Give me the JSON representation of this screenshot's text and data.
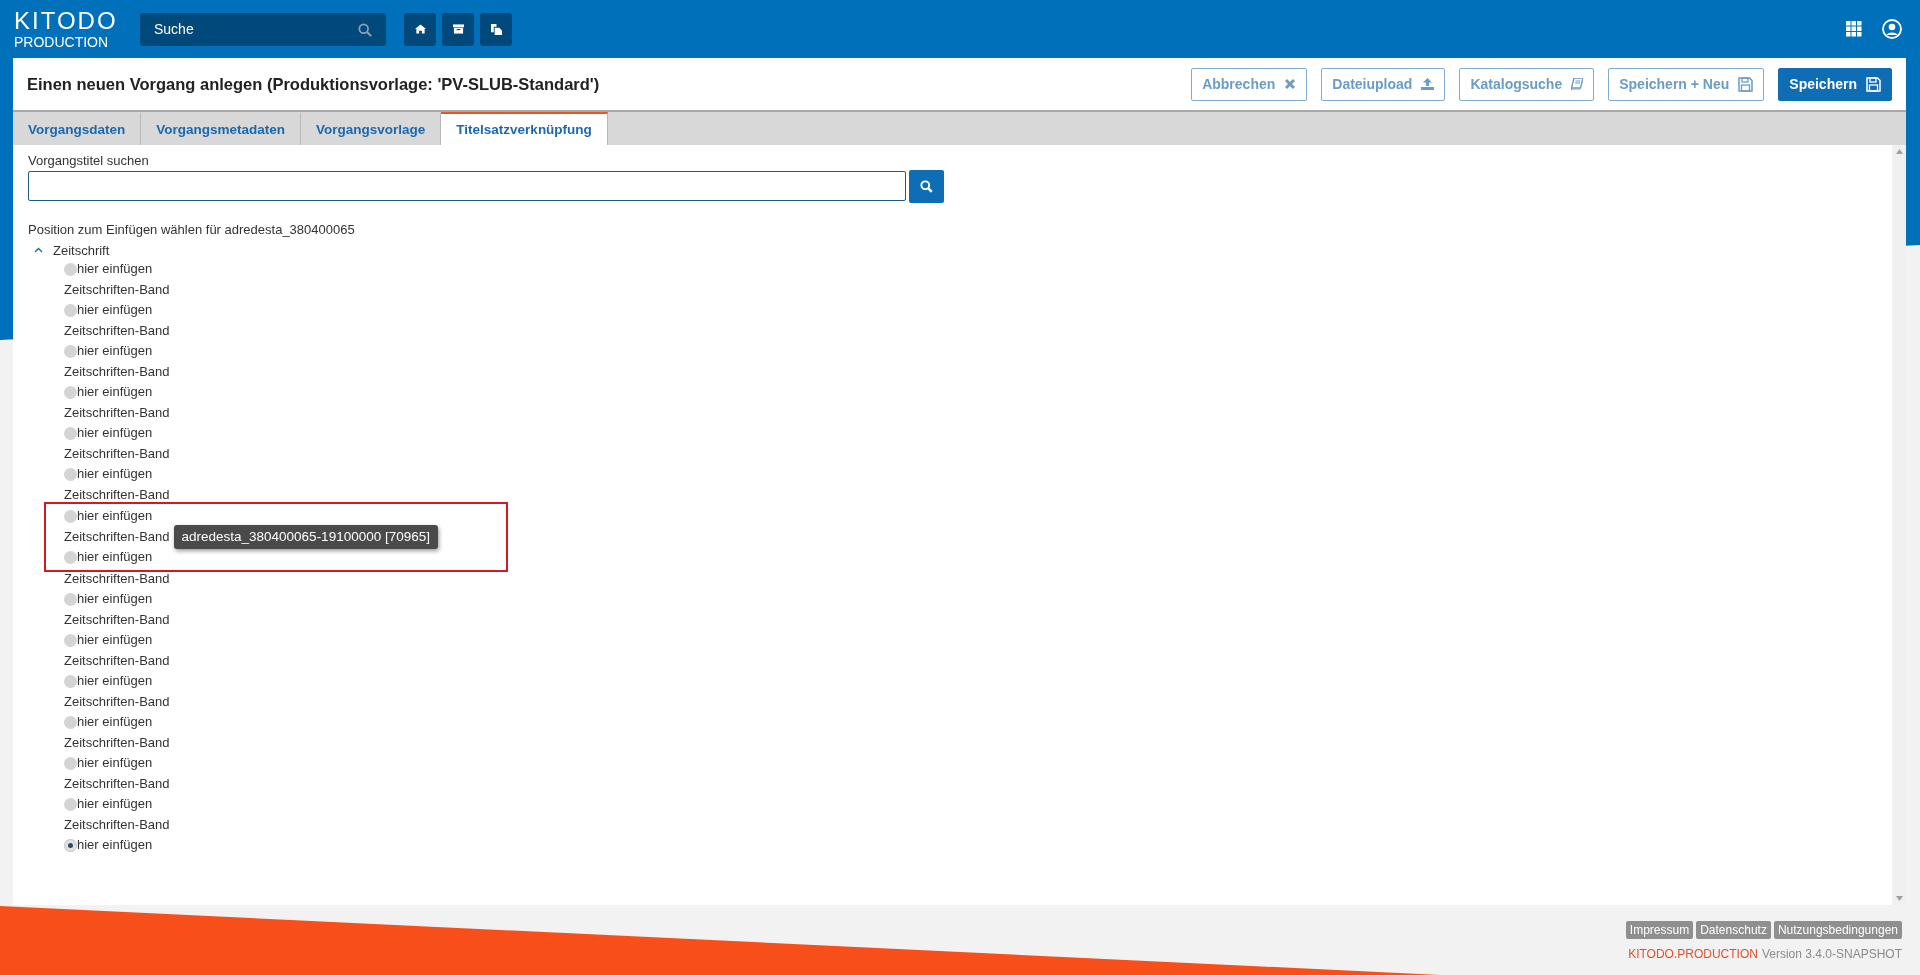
{
  "topbar": {
    "logo_line1": "KITODO",
    "logo_line2": "PRODUCTION",
    "search": {
      "placeholder": "Suche"
    },
    "nav": [
      {
        "kind": "home"
      },
      {
        "kind": "archive"
      },
      {
        "kind": "copy"
      }
    ]
  },
  "header": {
    "title": "Einen neuen Vorgang anlegen (Produktionsvorlage: 'PV-SLUB-Standard')",
    "buttons": [
      {
        "label": "Abbrechen",
        "kind": "cancel",
        "primary": false
      },
      {
        "label": "Dateiupload",
        "kind": "upload",
        "primary": false
      },
      {
        "label": "Katalogsuche",
        "kind": "book",
        "primary": false
      },
      {
        "label": "Speichern + Neu",
        "kind": "save",
        "primary": false
      },
      {
        "label": "Speichern",
        "kind": "save",
        "primary": true
      }
    ]
  },
  "tabs": [
    {
      "label": "Vorgangsdaten",
      "selected": false
    },
    {
      "label": "Vorgangsmetadaten",
      "selected": false
    },
    {
      "label": "Vorgangsvorlage",
      "selected": false
    },
    {
      "label": "Titelsatzverknüpfung",
      "selected": true
    }
  ],
  "search": {
    "label": "Vorgangstitel suchen"
  },
  "tree": {
    "caption": "Position zum Einfügen wählen für adredesta_380400065",
    "root": {
      "label": "Zeitschrift",
      "expanded": true,
      "children": [
        {
          "kind": "insert",
          "label": "hier einfügen",
          "selected": false
        },
        {
          "kind": "band",
          "label": "Zeitschriften-Band"
        },
        {
          "kind": "insert",
          "label": "hier einfügen",
          "selected": false
        },
        {
          "kind": "band",
          "label": "Zeitschriften-Band"
        },
        {
          "kind": "insert",
          "label": "hier einfügen",
          "selected": false
        },
        {
          "kind": "band",
          "label": "Zeitschriften-Band"
        },
        {
          "kind": "insert",
          "label": "hier einfügen",
          "selected": false
        },
        {
          "kind": "band",
          "label": "Zeitschriften-Band"
        },
        {
          "kind": "insert",
          "label": "hier einfügen",
          "selected": false
        },
        {
          "kind": "band",
          "label": "Zeitschriften-Band"
        },
        {
          "kind": "insert",
          "label": "hier einfügen",
          "selected": false
        },
        {
          "kind": "band",
          "label": "Zeitschriften-Band"
        },
        {
          "kind": "insert",
          "label": "hier einfügen",
          "selected": false,
          "highlighted": true
        },
        {
          "kind": "band",
          "label": "Zeitschriften-Band",
          "highlighted": true,
          "tooltip": "adredesta_380400065-19100000 [70965]"
        },
        {
          "kind": "insert",
          "label": "hier einfügen",
          "selected": false,
          "highlighted": true
        },
        {
          "kind": "band",
          "label": "Zeitschriften-Band"
        },
        {
          "kind": "insert",
          "label": "hier einfügen",
          "selected": false
        },
        {
          "kind": "band",
          "label": "Zeitschriften-Band"
        },
        {
          "kind": "insert",
          "label": "hier einfügen",
          "selected": false
        },
        {
          "kind": "band",
          "label": "Zeitschriften-Band"
        },
        {
          "kind": "insert",
          "label": "hier einfügen",
          "selected": false
        },
        {
          "kind": "band",
          "label": "Zeitschriften-Band"
        },
        {
          "kind": "insert",
          "label": "hier einfügen",
          "selected": false
        },
        {
          "kind": "band",
          "label": "Zeitschriften-Band"
        },
        {
          "kind": "insert",
          "label": "hier einfügen",
          "selected": false
        },
        {
          "kind": "band",
          "label": "Zeitschriften-Band"
        },
        {
          "kind": "insert",
          "label": "hier einfügen",
          "selected": false
        },
        {
          "kind": "band",
          "label": "Zeitschriften-Band"
        },
        {
          "kind": "insert",
          "label": "hier einfügen",
          "selected": true
        }
      ]
    }
  },
  "footer": {
    "links": [
      "Impressum",
      "Datenschutz",
      "Nutzungsbedingungen"
    ],
    "brand": "KITODO.PRODUCTION",
    "version": "Version 3.4.0-SNAPSHOT"
  }
}
